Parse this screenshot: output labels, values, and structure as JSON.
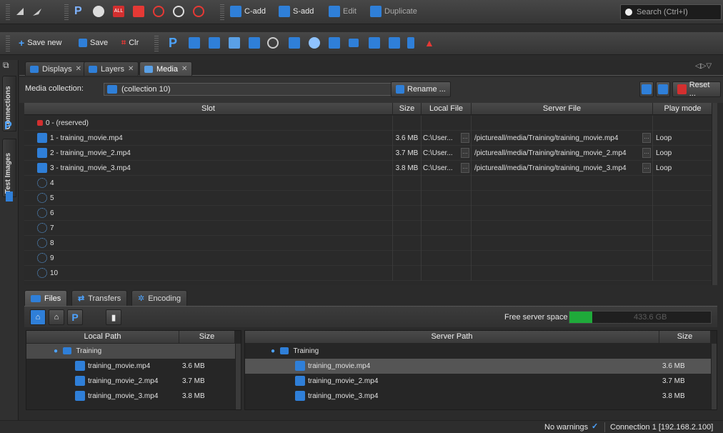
{
  "toolbar1": {
    "cadd": "C-add",
    "sadd": "S-add",
    "edit": "Edit",
    "duplicate": "Duplicate",
    "search_placeholder": "Search (Ctrl+I)"
  },
  "toolbar2": {
    "save_new": "Save new",
    "save": "Save",
    "clr": "Clr"
  },
  "sidebar": {
    "connections": "Connections",
    "test_images": "Test Images"
  },
  "tabs": [
    {
      "label": "Displays"
    },
    {
      "label": "Layers"
    },
    {
      "label": "Media"
    }
  ],
  "collection": {
    "label": "Media collection:",
    "value": "(collection 10)",
    "rename": "Rename ...",
    "reset": "Reset ..."
  },
  "media_table": {
    "columns": [
      "Slot",
      "Size",
      "Local File",
      "Server File",
      "Play mode"
    ],
    "rows": [
      {
        "slot": "0 - (reserved)",
        "size": "",
        "local": "",
        "server": "",
        "mode": ""
      },
      {
        "slot": "1 - training_movie.mp4",
        "size": "3.6 MB",
        "local": "C:\\User...",
        "server": "/pictureall/media/Training/training_movie.mp4",
        "mode": "Loop"
      },
      {
        "slot": "2 - training_movie_2.mp4",
        "size": "3.7 MB",
        "local": "C:\\User...",
        "server": "/pictureall/media/Training/training_movie_2.mp4",
        "mode": "Loop"
      },
      {
        "slot": "3 - training_movie_3.mp4",
        "size": "3.8 MB",
        "local": "C:\\User...",
        "server": "/pictureall/media/Training/training_movie_3.mp4",
        "mode": "Loop"
      },
      {
        "slot": "4"
      },
      {
        "slot": "5"
      },
      {
        "slot": "6"
      },
      {
        "slot": "7"
      },
      {
        "slot": "8"
      },
      {
        "slot": "9"
      },
      {
        "slot": "10"
      }
    ]
  },
  "bottom_tabs": [
    {
      "label": "Files"
    },
    {
      "label": "Transfers"
    },
    {
      "label": "Encoding"
    }
  ],
  "files_toolbar": {
    "free_space_label": "Free server space",
    "free_space_value": "433.6 GB",
    "free_space_fraction": 0.16
  },
  "local_panel": {
    "columns": [
      "Local Path",
      "Size"
    ],
    "folder": "Training",
    "files": [
      {
        "name": "training_movie.mp4",
        "size": "3.6 MB"
      },
      {
        "name": "training_movie_2.mp4",
        "size": "3.7 MB"
      },
      {
        "name": "training_movie_3.mp4",
        "size": "3.8 MB"
      }
    ]
  },
  "server_panel": {
    "columns": [
      "Server Path",
      "Size"
    ],
    "folder": "Training",
    "files": [
      {
        "name": "training_movie.mp4",
        "size": "3.6 MB"
      },
      {
        "name": "training_movie_2.mp4",
        "size": "3.7 MB"
      },
      {
        "name": "training_movie_3.mp4",
        "size": "3.8 MB"
      }
    ]
  },
  "status": {
    "warnings": "No warnings",
    "connection": "Connection 1 [192.168.2.100]"
  },
  "colors": {
    "accent_blue": "#1e88e5",
    "red": "#d32f2f",
    "green": "#1faa3a"
  }
}
